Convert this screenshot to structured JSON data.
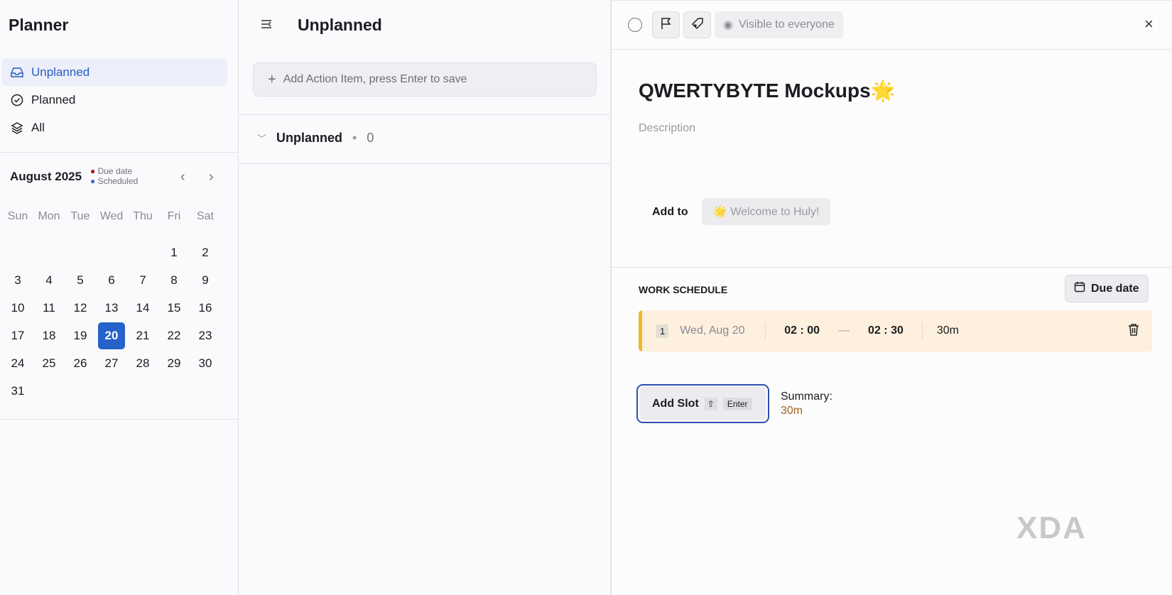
{
  "sidebar": {
    "title": "Planner",
    "nav": [
      {
        "label": "Unplanned",
        "icon": "inbox-icon"
      },
      {
        "label": "Planned",
        "icon": "check-circle-icon"
      },
      {
        "label": "All",
        "icon": "layers-icon"
      }
    ],
    "calendar": {
      "month": "August 2025",
      "legend_due": "Due date",
      "legend_scheduled": "Scheduled",
      "due_color": "#a01c1c",
      "scheduled_color": "#3c6fd1",
      "weekdays": [
        "Sun",
        "Mon",
        "Tue",
        "Wed",
        "Thu",
        "Fri",
        "Sat"
      ],
      "first_weekday_index": 5,
      "days": 31,
      "selected_day": 20
    }
  },
  "middle": {
    "title": "Unplanned",
    "add_placeholder": "Add Action Item, press Enter to save",
    "group_label": "Unplanned",
    "group_count": "0"
  },
  "detail": {
    "visibility": "Visible to everyone",
    "title": "QWERTYBYTE Mockups🌟",
    "description_placeholder": "Description",
    "add_to_label": "Add to",
    "add_to_value": "🌟 Welcome to Huly!",
    "work_schedule_label": "WORK SCHEDULE",
    "due_date_button": "Due date",
    "slots": [
      {
        "index": "1",
        "date": "Wed, Aug 20",
        "start": "02 : 00",
        "sep": "—",
        "end": "02 : 30",
        "duration": "30m"
      }
    ],
    "add_slot_label": "Add Slot",
    "add_slot_shortcut": "Enter",
    "summary_label": "Summary:",
    "summary_value": "30m"
  },
  "watermark": "XDA"
}
